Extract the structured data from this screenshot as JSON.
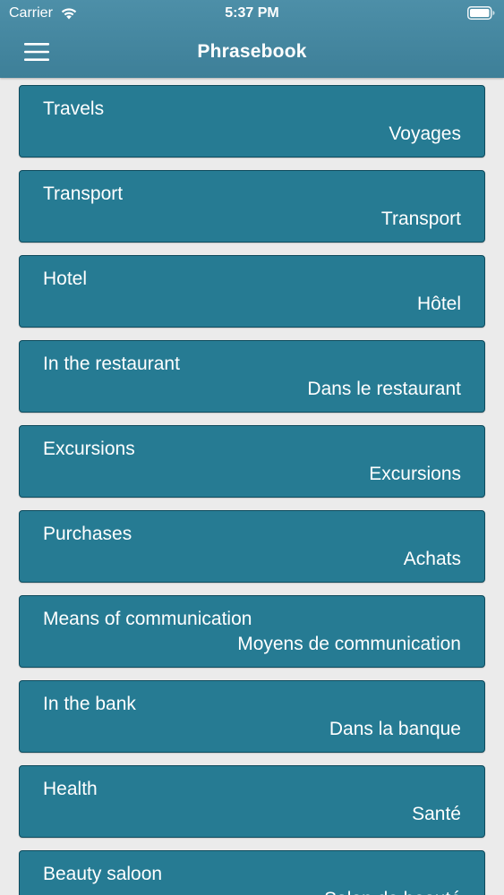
{
  "status_bar": {
    "carrier": "Carrier",
    "time": "5:37 PM"
  },
  "nav": {
    "title": "Phrasebook",
    "menu_icon": "hamburger-menu-icon"
  },
  "colors": {
    "header": "#3d7f98",
    "card_background": "#267b93",
    "card_border": "#0e4a5c",
    "page_background": "#ebebeb",
    "text": "#ffffff"
  },
  "categories": [
    {
      "en": "Travels",
      "fr": "Voyages"
    },
    {
      "en": "Transport",
      "fr": "Transport"
    },
    {
      "en": "Hotel",
      "fr": "Hôtel"
    },
    {
      "en": "In the restaurant",
      "fr": "Dans le restaurant"
    },
    {
      "en": "Excursions",
      "fr": "Excursions"
    },
    {
      "en": "Purchases",
      "fr": "Achats"
    },
    {
      "en": "Means of communication",
      "fr": "Moyens de communication"
    },
    {
      "en": "In the bank",
      "fr": "Dans la banque"
    },
    {
      "en": "Health",
      "fr": "Santé"
    },
    {
      "en": "Beauty saloon",
      "fr": "Salon de beauté"
    }
  ]
}
